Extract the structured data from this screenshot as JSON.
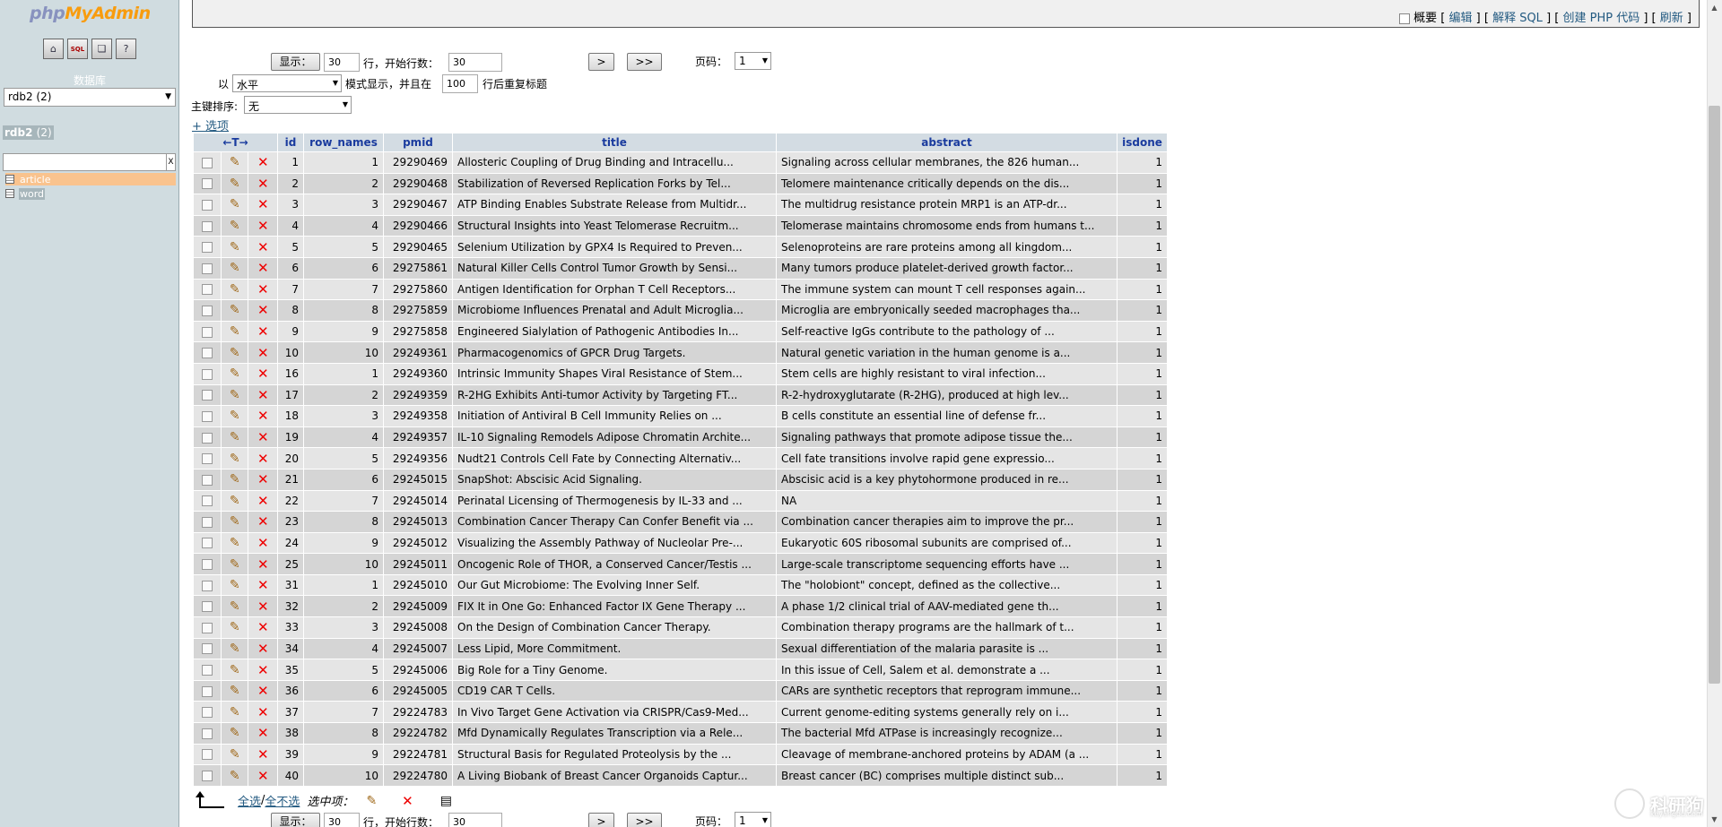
{
  "sidebar": {
    "logo": {
      "php": "php",
      "my": "My",
      "admin": "Admin"
    },
    "quick_icons": [
      "home-icon",
      "sql-icon",
      "query-window-icon",
      "docs-icon"
    ],
    "db_label": "数据库",
    "db_selected": "rdb2 (2)",
    "db_name": "rdb2",
    "db_count": "(2)",
    "tables": [
      {
        "name": "article",
        "selected": true
      },
      {
        "name": "word",
        "selected": false
      }
    ]
  },
  "top_links": {
    "profiling": "概要",
    "edit": "编辑",
    "explain": "解释 SQL",
    "php_code": "创建 PHP 代码",
    "refresh": "刷新"
  },
  "nav": {
    "show_btn": "显示：",
    "rows_value": "30",
    "rows_label": "行，开始行数：",
    "start_value": "30",
    "next_btn": ">",
    "last_btn": ">>",
    "page_label": "页码：",
    "page_value": "1",
    "mode_prefix": "以",
    "mode_value": "水平",
    "mode_label": "模式显示，并且在",
    "repeat_value": "100",
    "repeat_label": "行后重复标题",
    "sort_label": "主键排序:",
    "sort_value": "无",
    "options_link": "+ 选项"
  },
  "table": {
    "resize_label": "←T→",
    "columns": [
      "id",
      "row_names",
      "pmid",
      "title",
      "abstract",
      "isdone"
    ],
    "rows": [
      [
        "1",
        "1",
        "29290469",
        "Allosteric Coupling of Drug Binding and Intracellu...",
        "Signaling across cellular membranes, the 826 human...",
        "1"
      ],
      [
        "2",
        "2",
        "29290468",
        "Stabilization of Reversed Replication Forks by Tel...",
        "Telomere maintenance critically depends on the dis...",
        "1"
      ],
      [
        "3",
        "3",
        "29290467",
        "ATP Binding Enables Substrate Release from Multidr...",
        "The multidrug resistance protein MRP1 is an ATP-dr...",
        "1"
      ],
      [
        "4",
        "4",
        "29290466",
        "Structural Insights into Yeast Telomerase Recruitm...",
        "Telomerase maintains chromosome ends from humans t...",
        "1"
      ],
      [
        "5",
        "5",
        "29290465",
        "Selenium Utilization by GPX4 Is Required to Preven...",
        "Selenoproteins are rare proteins among all kingdom...",
        "1"
      ],
      [
        "6",
        "6",
        "29275861",
        "Natural Killer Cells Control Tumor Growth by Sensi...",
        "Many tumors produce platelet-derived growth factor...",
        "1"
      ],
      [
        "7",
        "7",
        "29275860",
        "Antigen Identification for Orphan T Cell Receptors...",
        "The immune system can mount T cell responses again...",
        "1"
      ],
      [
        "8",
        "8",
        "29275859",
        "Microbiome Influences Prenatal and Adult Microglia...",
        "Microglia are embryonically seeded macrophages tha...",
        "1"
      ],
      [
        "9",
        "9",
        "29275858",
        "Engineered Sialylation of Pathogenic Antibodies In...",
        "Self-reactive IgGs contribute to the pathology of ...",
        "1"
      ],
      [
        "10",
        "10",
        "29249361",
        "Pharmacogenomics of GPCR Drug Targets.",
        "Natural genetic variation in the human genome is a...",
        "1"
      ],
      [
        "16",
        "1",
        "29249360",
        "Intrinsic Immunity Shapes Viral Resistance of Stem...",
        "Stem cells are highly resistant to viral infection...",
        "1"
      ],
      [
        "17",
        "2",
        "29249359",
        "R-2HG Exhibits Anti-tumor Activity by Targeting FT...",
        "R-2-hydroxyglutarate (R-2HG), produced at high lev...",
        "1"
      ],
      [
        "18",
        "3",
        "29249358",
        "Initiation of Antiviral B Cell Immunity Relies on ...",
        "B cells constitute an essential line of defense fr...",
        "1"
      ],
      [
        "19",
        "4",
        "29249357",
        "IL-10 Signaling Remodels Adipose Chromatin Archite...",
        "Signaling pathways that promote adipose tissue the...",
        "1"
      ],
      [
        "20",
        "5",
        "29249356",
        "Nudt21 Controls Cell Fate by Connecting Alternativ...",
        "Cell fate transitions involve rapid gene expressio...",
        "1"
      ],
      [
        "21",
        "6",
        "29245015",
        "SnapShot: Abscisic Acid Signaling.",
        "Abscisic acid is a key phytohormone produced in re...",
        "1"
      ],
      [
        "22",
        "7",
        "29245014",
        "Perinatal Licensing of Thermogenesis by IL-33 and ...",
        "NA",
        "1"
      ],
      [
        "23",
        "8",
        "29245013",
        "Combination Cancer Therapy Can Confer Benefit via ...",
        "Combination cancer therapies aim to improve the pr...",
        "1"
      ],
      [
        "24",
        "9",
        "29245012",
        "Visualizing the Assembly Pathway of Nucleolar Pre-...",
        "Eukaryotic 60S ribosomal subunits are comprised of...",
        "1"
      ],
      [
        "25",
        "10",
        "29245011",
        "Oncogenic Role of THOR, a Conserved Cancer/Testis ...",
        "Large-scale transcriptome sequencing efforts have ...",
        "1"
      ],
      [
        "31",
        "1",
        "29245010",
        "Our Gut Microbiome: The Evolving Inner Self.",
        "The \"holobiont\" concept, defined as the collective...",
        "1"
      ],
      [
        "32",
        "2",
        "29245009",
        "FIX It in One Go: Enhanced Factor IX Gene Therapy ...",
        "A phase 1/2 clinical trial of AAV-mediated gene th...",
        "1"
      ],
      [
        "33",
        "3",
        "29245008",
        "On the Design of Combination Cancer Therapy.",
        "Combination therapy programs are the hallmark of t...",
        "1"
      ],
      [
        "34",
        "4",
        "29245007",
        "Less Lipid, More Commitment.",
        "Sexual differentiation of the malaria parasite is ...",
        "1"
      ],
      [
        "35",
        "5",
        "29245006",
        "Big Role for a Tiny Genome.",
        "In this issue of Cell, Salem et al. demonstrate a ...",
        "1"
      ],
      [
        "36",
        "6",
        "29245005",
        "CD19 CAR T Cells.",
        "CARs are synthetic receptors that reprogram immune...",
        "1"
      ],
      [
        "37",
        "7",
        "29224783",
        "In Vivo Target Gene Activation via CRISPR/Cas9-Med...",
        "Current genome-editing systems generally rely on i...",
        "1"
      ],
      [
        "38",
        "8",
        "29224782",
        "Mfd Dynamically Regulates Transcription via a Rele...",
        "The bacterial Mfd ATPase is increasingly recognize...",
        "1"
      ],
      [
        "39",
        "9",
        "29224781",
        "Structural Basis for Regulated Proteolysis by the ...",
        "Cleavage of membrane-anchored proteins by ADAM (a ...",
        "1"
      ],
      [
        "40",
        "10",
        "29224780",
        "A Living Biobank of Breast Cancer Organoids Captur...",
        "Breast cancer (BC) comprises multiple distinct sub...",
        "1"
      ]
    ]
  },
  "bottom": {
    "check_all": "全选",
    "sep": " / ",
    "uncheck_all": "全不选",
    "with_selected": "选中项："
  },
  "watermark": {
    "text": "科研狗",
    "sub": "keyangou.com"
  }
}
